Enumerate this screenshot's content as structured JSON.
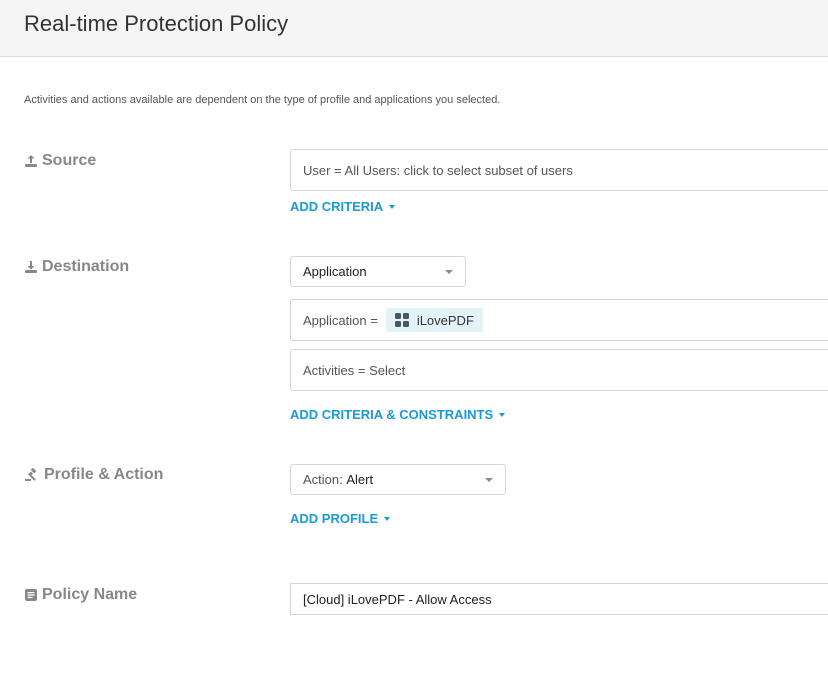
{
  "header": {
    "title": "Real-time Protection Policy"
  },
  "note": "Activities and actions available are dependent on the type of profile and applications you selected.",
  "source": {
    "label": "Source",
    "icon": "upload-icon",
    "user_field": "User = All Users: click to select subset of users",
    "add_criteria": "ADD CRITERIA"
  },
  "destination": {
    "label": "Destination",
    "icon": "download-icon",
    "type_select": "Application",
    "app_prefix": "Application =",
    "app_chip": "iLovePDF",
    "activities": "Activities = Select",
    "add_criteria": "ADD CRITERIA & CONSTRAINTS"
  },
  "profile": {
    "label": "Profile & Action",
    "icon": "gavel-icon",
    "action_prefix": "Action:",
    "action_value": "Alert",
    "add_profile": "ADD PROFILE"
  },
  "policy_name": {
    "label": "Policy Name",
    "icon": "document-icon",
    "value": "[Cloud] iLovePDF - Allow Access"
  },
  "colors": {
    "accent": "#1a9ad6",
    "chip_bg": "#e3f3f8",
    "label": "#888888"
  }
}
